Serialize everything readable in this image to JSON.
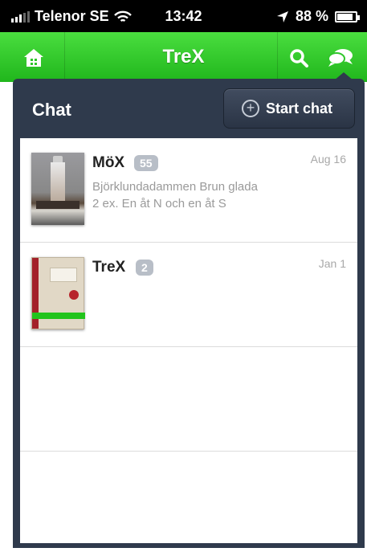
{
  "status_bar": {
    "carrier": "Telenor SE",
    "time": "13:42",
    "battery": "88 %",
    "battery_level": 0.88
  },
  "navbar": {
    "title": "TreX",
    "icons": [
      "home-icon",
      "search-icon",
      "chat-bubbles-icon"
    ],
    "accent_color": "#2fc62a"
  },
  "panel": {
    "heading": "Chat",
    "start_chat_label": "Start chat",
    "background_color": "#2f3a4c"
  },
  "chats": [
    {
      "name": "MöX",
      "badge": "55",
      "date": "Aug 16",
      "preview_line1": "Björklundadammen Brun glada",
      "preview_line2": "2 ex. En åt N och en åt S"
    },
    {
      "name": "TreX",
      "badge": "2",
      "date": "Jan 1",
      "preview_line1": "",
      "preview_line2": ""
    }
  ]
}
